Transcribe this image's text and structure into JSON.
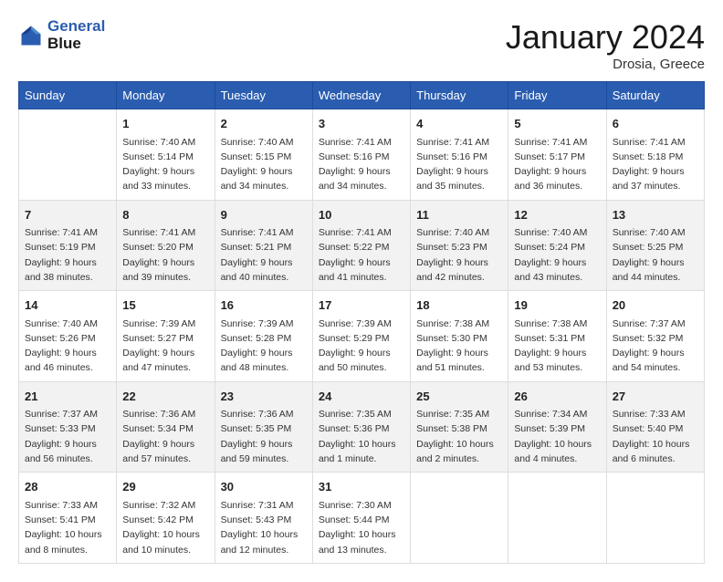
{
  "header": {
    "logo_line1": "General",
    "logo_line2": "Blue",
    "month": "January 2024",
    "location": "Drosia, Greece"
  },
  "weekdays": [
    "Sunday",
    "Monday",
    "Tuesday",
    "Wednesday",
    "Thursday",
    "Friday",
    "Saturday"
  ],
  "weeks": [
    [
      {
        "day": "",
        "info": ""
      },
      {
        "day": "1",
        "info": "Sunrise: 7:40 AM\nSunset: 5:14 PM\nDaylight: 9 hours\nand 33 minutes."
      },
      {
        "day": "2",
        "info": "Sunrise: 7:40 AM\nSunset: 5:15 PM\nDaylight: 9 hours\nand 34 minutes."
      },
      {
        "day": "3",
        "info": "Sunrise: 7:41 AM\nSunset: 5:16 PM\nDaylight: 9 hours\nand 34 minutes."
      },
      {
        "day": "4",
        "info": "Sunrise: 7:41 AM\nSunset: 5:16 PM\nDaylight: 9 hours\nand 35 minutes."
      },
      {
        "day": "5",
        "info": "Sunrise: 7:41 AM\nSunset: 5:17 PM\nDaylight: 9 hours\nand 36 minutes."
      },
      {
        "day": "6",
        "info": "Sunrise: 7:41 AM\nSunset: 5:18 PM\nDaylight: 9 hours\nand 37 minutes."
      }
    ],
    [
      {
        "day": "7",
        "info": "Sunrise: 7:41 AM\nSunset: 5:19 PM\nDaylight: 9 hours\nand 38 minutes."
      },
      {
        "day": "8",
        "info": "Sunrise: 7:41 AM\nSunset: 5:20 PM\nDaylight: 9 hours\nand 39 minutes."
      },
      {
        "day": "9",
        "info": "Sunrise: 7:41 AM\nSunset: 5:21 PM\nDaylight: 9 hours\nand 40 minutes."
      },
      {
        "day": "10",
        "info": "Sunrise: 7:41 AM\nSunset: 5:22 PM\nDaylight: 9 hours\nand 41 minutes."
      },
      {
        "day": "11",
        "info": "Sunrise: 7:40 AM\nSunset: 5:23 PM\nDaylight: 9 hours\nand 42 minutes."
      },
      {
        "day": "12",
        "info": "Sunrise: 7:40 AM\nSunset: 5:24 PM\nDaylight: 9 hours\nand 43 minutes."
      },
      {
        "day": "13",
        "info": "Sunrise: 7:40 AM\nSunset: 5:25 PM\nDaylight: 9 hours\nand 44 minutes."
      }
    ],
    [
      {
        "day": "14",
        "info": "Sunrise: 7:40 AM\nSunset: 5:26 PM\nDaylight: 9 hours\nand 46 minutes."
      },
      {
        "day": "15",
        "info": "Sunrise: 7:39 AM\nSunset: 5:27 PM\nDaylight: 9 hours\nand 47 minutes."
      },
      {
        "day": "16",
        "info": "Sunrise: 7:39 AM\nSunset: 5:28 PM\nDaylight: 9 hours\nand 48 minutes."
      },
      {
        "day": "17",
        "info": "Sunrise: 7:39 AM\nSunset: 5:29 PM\nDaylight: 9 hours\nand 50 minutes."
      },
      {
        "day": "18",
        "info": "Sunrise: 7:38 AM\nSunset: 5:30 PM\nDaylight: 9 hours\nand 51 minutes."
      },
      {
        "day": "19",
        "info": "Sunrise: 7:38 AM\nSunset: 5:31 PM\nDaylight: 9 hours\nand 53 minutes."
      },
      {
        "day": "20",
        "info": "Sunrise: 7:37 AM\nSunset: 5:32 PM\nDaylight: 9 hours\nand 54 minutes."
      }
    ],
    [
      {
        "day": "21",
        "info": "Sunrise: 7:37 AM\nSunset: 5:33 PM\nDaylight: 9 hours\nand 56 minutes."
      },
      {
        "day": "22",
        "info": "Sunrise: 7:36 AM\nSunset: 5:34 PM\nDaylight: 9 hours\nand 57 minutes."
      },
      {
        "day": "23",
        "info": "Sunrise: 7:36 AM\nSunset: 5:35 PM\nDaylight: 9 hours\nand 59 minutes."
      },
      {
        "day": "24",
        "info": "Sunrise: 7:35 AM\nSunset: 5:36 PM\nDaylight: 10 hours\nand 1 minute."
      },
      {
        "day": "25",
        "info": "Sunrise: 7:35 AM\nSunset: 5:38 PM\nDaylight: 10 hours\nand 2 minutes."
      },
      {
        "day": "26",
        "info": "Sunrise: 7:34 AM\nSunset: 5:39 PM\nDaylight: 10 hours\nand 4 minutes."
      },
      {
        "day": "27",
        "info": "Sunrise: 7:33 AM\nSunset: 5:40 PM\nDaylight: 10 hours\nand 6 minutes."
      }
    ],
    [
      {
        "day": "28",
        "info": "Sunrise: 7:33 AM\nSunset: 5:41 PM\nDaylight: 10 hours\nand 8 minutes."
      },
      {
        "day": "29",
        "info": "Sunrise: 7:32 AM\nSunset: 5:42 PM\nDaylight: 10 hours\nand 10 minutes."
      },
      {
        "day": "30",
        "info": "Sunrise: 7:31 AM\nSunset: 5:43 PM\nDaylight: 10 hours\nand 12 minutes."
      },
      {
        "day": "31",
        "info": "Sunrise: 7:30 AM\nSunset: 5:44 PM\nDaylight: 10 hours\nand 13 minutes."
      },
      {
        "day": "",
        "info": ""
      },
      {
        "day": "",
        "info": ""
      },
      {
        "day": "",
        "info": ""
      }
    ]
  ]
}
